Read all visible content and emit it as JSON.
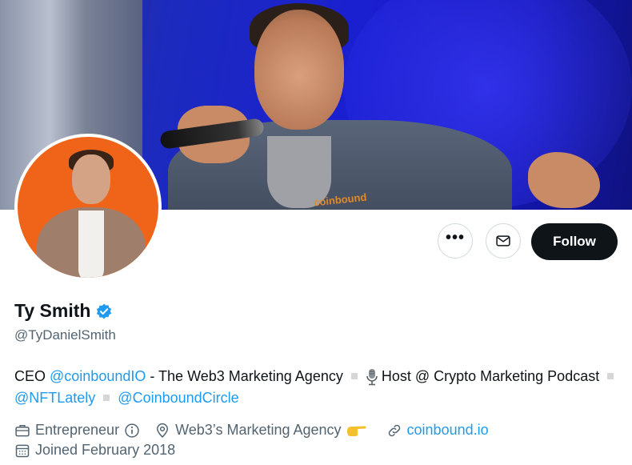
{
  "profile": {
    "name": "Ty Smith",
    "handle": "@TyDanielSmith"
  },
  "banner": {
    "shirt_logo_text": "coinbound"
  },
  "actions": {
    "more_label": "•••",
    "follow_label": "Follow"
  },
  "bio": {
    "part1": "CEO ",
    "mention_agency": "@coinboundIO",
    "part2": " - The Web3 Marketing Agency",
    "part3": "Host @ Crypto Marketing Podcast",
    "mention_nft": "@NFTLately",
    "mention_circle": "@CoinboundCircle"
  },
  "meta": {
    "category": "Entrepreneur",
    "location": "Web3’s Marketing Agency",
    "website": "coinbound.io",
    "joined": "Joined February 2018"
  },
  "icons": {
    "verified": "verified-badge-icon",
    "briefcase": "briefcase-icon",
    "info": "info-icon",
    "location": "location-pin-icon",
    "link": "link-icon",
    "calendar": "calendar-icon",
    "mail": "mail-icon",
    "more": "more-icon",
    "microphone": "microphone-emoji-icon",
    "pointing_hand": "pointing-hand-emoji-icon"
  },
  "colors": {
    "accent": "#1d9bf0",
    "follow_button": "#0f1419",
    "muted_text": "#536471",
    "avatar_background": "#f0641a"
  }
}
